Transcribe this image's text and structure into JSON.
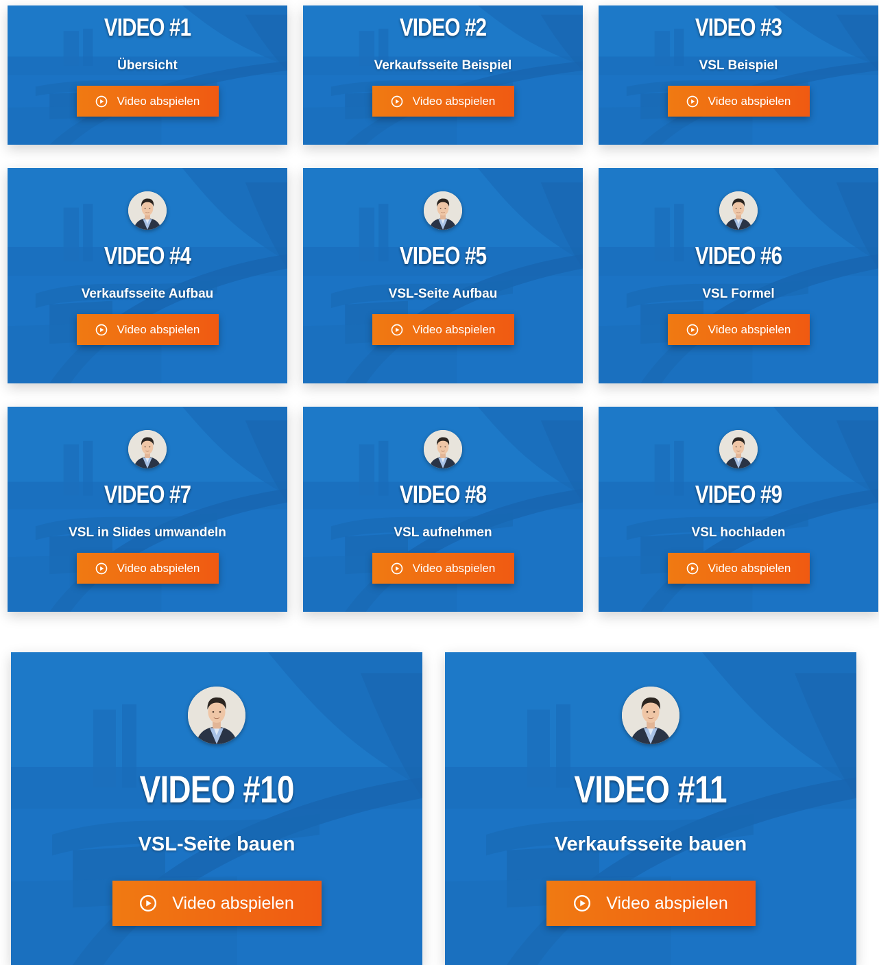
{
  "videos": [
    {
      "title": "VIDEO #1",
      "subtitle": "Übersicht",
      "button": "Video abspielen"
    },
    {
      "title": "VIDEO #2",
      "subtitle": "Verkaufsseite Beispiel",
      "button": "Video abspielen"
    },
    {
      "title": "VIDEO #3",
      "subtitle": "VSL Beispiel",
      "button": "Video abspielen"
    },
    {
      "title": "VIDEO #4",
      "subtitle": "Verkaufsseite Aufbau",
      "button": "Video abspielen"
    },
    {
      "title": "VIDEO #5",
      "subtitle": "VSL-Seite Aufbau",
      "button": "Video abspielen"
    },
    {
      "title": "VIDEO #6",
      "subtitle": "VSL Formel",
      "button": "Video abspielen"
    },
    {
      "title": "VIDEO #7",
      "subtitle": "VSL in Slides umwandeln",
      "button": "Video abspielen"
    },
    {
      "title": "VIDEO #8",
      "subtitle": "VSL aufnehmen",
      "button": "Video abspielen"
    },
    {
      "title": "VIDEO #9",
      "subtitle": "VSL hochladen",
      "button": "Video abspielen"
    },
    {
      "title": "VIDEO #10",
      "subtitle": "VSL-Seite bauen",
      "button": "Video abspielen"
    },
    {
      "title": "VIDEO #11",
      "subtitle": "Verkaufsseite bauen",
      "button": "Video abspielen"
    }
  ],
  "colors": {
    "card_blue": "#1b73c4",
    "button_orange": "#f07a12",
    "button_red_orange": "#f05a12",
    "text": "#ffffff"
  },
  "icons": {
    "button_icon": "play-circle-icon",
    "avatar": "presenter-avatar"
  }
}
